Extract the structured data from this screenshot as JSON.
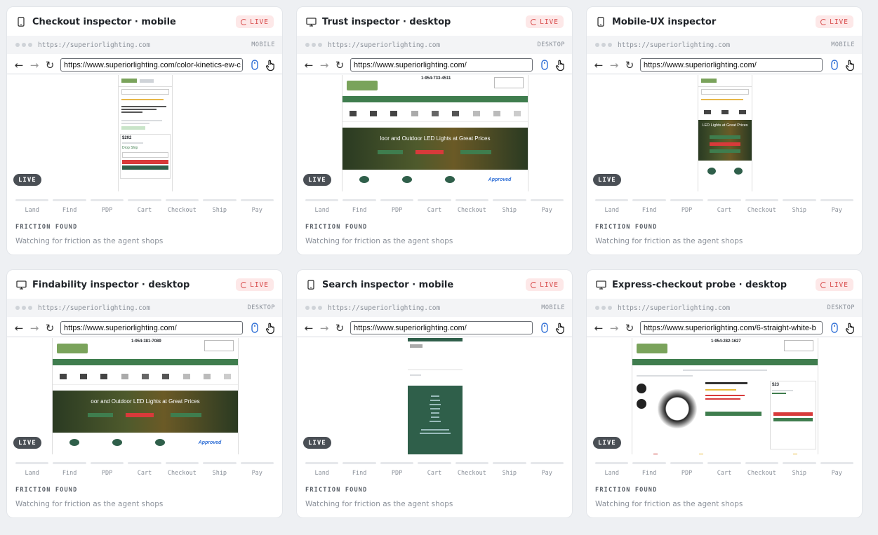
{
  "cards": [
    {
      "title": "Checkout inspector · mobile",
      "device": "mobile",
      "badge": "LIVE",
      "origin": "https://superiorlighting.com",
      "device_label": "MOBILE",
      "url": "https://www.superiorlighting.com/color-kinetics-ew-c",
      "viewport_live": "LIVE",
      "steps": [
        "Land",
        "Find",
        "PDP",
        "Cart",
        "Checkout",
        "Ship",
        "Pay"
      ],
      "friction_heading": "FRICTION FOUND",
      "friction_text": "Watching for friction as the agent shops",
      "preview": {
        "price": "$202",
        "drop_ship": "Drop Ship"
      }
    },
    {
      "title": "Trust inspector · desktop",
      "device": "desktop",
      "badge": "LIVE",
      "origin": "https://superiorlighting.com",
      "device_label": "DESKTOP",
      "url": "https://www.superiorlighting.com/",
      "viewport_live": "LIVE",
      "steps": [
        "Land",
        "Find",
        "PDP",
        "Cart",
        "Checkout",
        "Ship",
        "Pay"
      ],
      "friction_heading": "FRICTION FOUND",
      "friction_text": "Watching for friction as the agent shops",
      "preview": {
        "phone": "1-954-733-4511",
        "hero_text": "loor and Outdoor LED Lights at Great Prices",
        "approved": "Approved"
      }
    },
    {
      "title": "Mobile-UX inspector",
      "device": "mobile",
      "badge": "LIVE",
      "origin": "https://superiorlighting.com",
      "device_label": "MOBILE",
      "url": "https://www.superiorlighting.com/",
      "viewport_live": "LIVE",
      "steps": [
        "Land",
        "Find",
        "PDP",
        "Cart",
        "Checkout",
        "Ship",
        "Pay"
      ],
      "friction_heading": "FRICTION FOUND",
      "friction_text": "Watching for friction as the agent shops",
      "preview": {
        "hero_text": "LED Lights at Great Prices"
      }
    },
    {
      "title": "Findability inspector · desktop",
      "device": "desktop",
      "badge": "LIVE",
      "origin": "https://superiorlighting.com",
      "device_label": "DESKTOP",
      "url": "https://www.superiorlighting.com/",
      "viewport_live": "LIVE",
      "steps": [
        "Land",
        "Find",
        "PDP",
        "Cart",
        "Checkout",
        "Ship",
        "Pay"
      ],
      "friction_heading": "FRICTION FOUND",
      "friction_text": "Watching for friction as the agent shops",
      "preview": {
        "phone": "1-954-381-7089",
        "hero_text": "oor and Outdoor LED Lights at Great Prices",
        "approved": "Approved"
      }
    },
    {
      "title": "Search inspector · mobile",
      "device": "mobile",
      "badge": "LIVE",
      "origin": "https://superiorlighting.com",
      "device_label": "MOBILE",
      "url": "https://www.superiorlighting.com/",
      "viewport_live": "LIVE",
      "steps": [
        "Land",
        "Find",
        "PDP",
        "Cart",
        "Checkout",
        "Ship",
        "Pay"
      ],
      "friction_heading": "FRICTION FOUND",
      "friction_text": "Watching for friction as the agent shops",
      "preview": {}
    },
    {
      "title": "Express-checkout probe · desktop",
      "device": "desktop",
      "badge": "LIVE",
      "origin": "https://superiorlighting.com",
      "device_label": "DESKTOP",
      "url": "https://www.superiorlighting.com/6-straight-white-b",
      "viewport_live": "LIVE",
      "steps": [
        "Land",
        "Find",
        "PDP",
        "Cart",
        "Checkout",
        "Ship",
        "Pay"
      ],
      "friction_heading": "FRICTION FOUND",
      "friction_text": "Watching for friction as the agent shops",
      "preview": {
        "phone": "1-954-282-1627",
        "price": "$23"
      }
    }
  ],
  "colors": {
    "live_red": "#d64545",
    "brand_green": "#3f7d4e",
    "page_bg": "#eef0f3"
  }
}
